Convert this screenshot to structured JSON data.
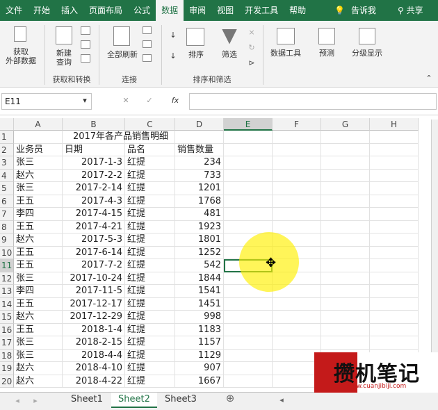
{
  "ribbon_tabs": [
    "文件",
    "开始",
    "插入",
    "页面布局",
    "公式",
    "数据",
    "审阅",
    "视图",
    "开发工具",
    "帮助"
  ],
  "active_tab": "数据",
  "tell_me": "告诉我",
  "share": "共享",
  "ribbon": {
    "get_external": "获取\n外部数据",
    "new_query": "新建\n查询",
    "refresh_all": "全部刷新",
    "sort": "排序",
    "filter": "筛选",
    "data_tools": "数据工具",
    "forecast": "预测",
    "outline": "分级显示",
    "group_get_transform": "获取和转换",
    "group_connections": "连接",
    "group_sort_filter": "排序和筛选"
  },
  "name_box": "E11",
  "fx_label": "fx",
  "columns": [
    "A",
    "B",
    "C",
    "D",
    "E",
    "F",
    "G",
    "H"
  ],
  "selected_column": "E",
  "selected_row": 11,
  "title": "2017年各产品销售明细",
  "headers": [
    "业务员",
    "日期",
    "品名",
    "销售数量"
  ],
  "rows": [
    [
      "张三",
      "2017-1-3",
      "红提",
      "234"
    ],
    [
      "赵六",
      "2017-2-2",
      "红提",
      "733"
    ],
    [
      "张三",
      "2017-2-14",
      "红提",
      "1201"
    ],
    [
      "王五",
      "2017-4-3",
      "红提",
      "1768"
    ],
    [
      "李四",
      "2017-4-15",
      "红提",
      "481"
    ],
    [
      "王五",
      "2017-4-21",
      "红提",
      "1923"
    ],
    [
      "赵六",
      "2017-5-3",
      "红提",
      "1801"
    ],
    [
      "王五",
      "2017-6-14",
      "红提",
      "1252"
    ],
    [
      "王五",
      "2017-7-2",
      "红提",
      "542"
    ],
    [
      "张三",
      "2017-10-24",
      "红提",
      "1844"
    ],
    [
      "李四",
      "2017-11-5",
      "红提",
      "1541"
    ],
    [
      "王五",
      "2017-12-17",
      "红提",
      "1451"
    ],
    [
      "赵六",
      "2017-12-29",
      "红提",
      "998"
    ],
    [
      "王五",
      "2018-1-4",
      "红提",
      "1183"
    ],
    [
      "张三",
      "2018-2-15",
      "红提",
      "1157"
    ],
    [
      "张三",
      "2018-4-4",
      "红提",
      "1129"
    ],
    [
      "赵六",
      "2018-4-10",
      "红提",
      "907"
    ],
    [
      "赵六",
      "2018-4-22",
      "红提",
      "1667"
    ]
  ],
  "sheets": [
    "Sheet1",
    "Sheet2",
    "Sheet3"
  ],
  "active_sheet": "Sheet2",
  "watermark": {
    "text": "攒机笔记",
    "url": "www.cuanjibiji.com"
  }
}
